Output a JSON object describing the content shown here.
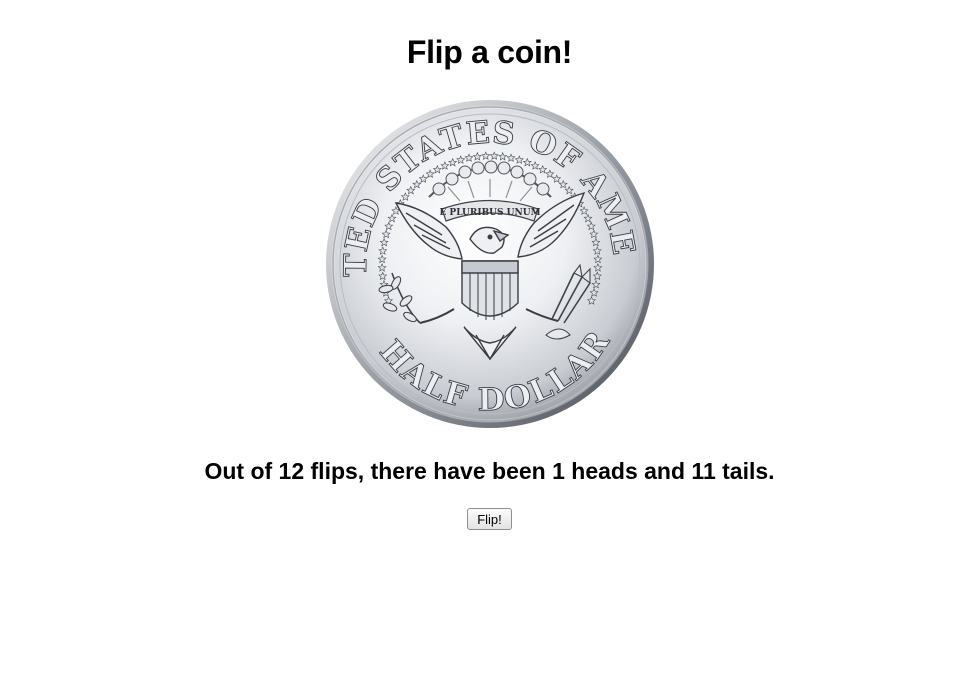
{
  "page": {
    "title": "Flip a coin!"
  },
  "coin": {
    "face": "reverse",
    "rim_text_top": "UNITED STATES OF AMERICA",
    "rim_text_bottom": "HALF DOLLAR",
    "motto": "E PLURIBUS UNUM",
    "colors": {
      "silver_light": "#f4f5f7",
      "silver_mid": "#c9ccd2",
      "silver_dark": "#6d717a",
      "relief_shadow": "#3a3d44"
    }
  },
  "summary": {
    "text": "Out of 12 flips, there have been 1 heads and 11 tails.",
    "total_flips": 12,
    "heads": 1,
    "tails": 11
  },
  "controls": {
    "flip_label": "Flip!"
  }
}
